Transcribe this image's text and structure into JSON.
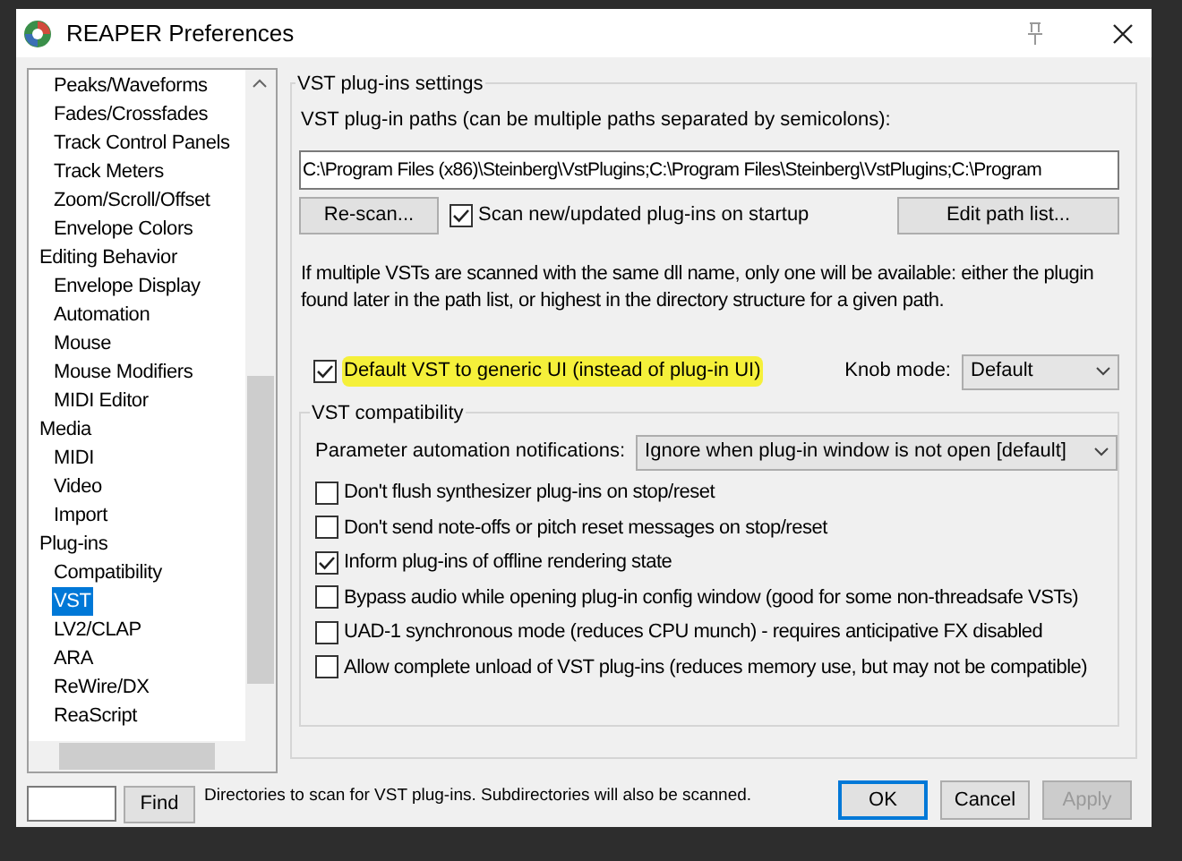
{
  "window": {
    "title": "REAPER Preferences"
  },
  "tree": {
    "items": [
      {
        "children": [
          {
            "label": "Peaks/Waveforms",
            "selected": false
          },
          {
            "label": "Fades/Crossfades",
            "selected": false
          },
          {
            "label": "Track Control Panels",
            "selected": false
          },
          {
            "label": "Track Meters",
            "selected": false
          },
          {
            "label": "Zoom/Scroll/Offset",
            "selected": false
          },
          {
            "label": "Envelope Colors",
            "selected": false
          }
        ]
      },
      {
        "label": "Editing Behavior",
        "selected": false,
        "children": [
          {
            "label": "Envelope Display",
            "selected": false
          },
          {
            "label": "Automation",
            "selected": false
          },
          {
            "label": "Mouse",
            "selected": false
          },
          {
            "label": "Mouse Modifiers",
            "selected": false
          },
          {
            "label": "MIDI Editor",
            "selected": false
          }
        ]
      },
      {
        "label": "Media",
        "selected": false,
        "children": [
          {
            "label": "MIDI",
            "selected": false
          },
          {
            "label": "Video",
            "selected": false
          },
          {
            "label": "Import",
            "selected": false
          }
        ]
      },
      {
        "label": "Plug-ins",
        "selected": false,
        "children": [
          {
            "label": "Compatibility",
            "selected": false
          },
          {
            "label": "VST",
            "selected": true
          },
          {
            "label": "LV2/CLAP",
            "selected": false
          },
          {
            "label": "ARA",
            "selected": false
          },
          {
            "label": "ReWire/DX",
            "selected": false
          },
          {
            "label": "ReaScript",
            "selected": false
          }
        ]
      }
    ]
  },
  "settings": {
    "group_title": "VST plug-ins settings",
    "paths_label": "VST plug-in paths (can be multiple paths separated by semicolons):",
    "paths_value": "C:\\Program Files (x86)\\Steinberg\\VstPlugins;C:\\Program Files\\Steinberg\\VstPlugins;C:\\Program",
    "rescan_button": "Re-scan...",
    "scan_on_startup": {
      "label": "Scan new/updated plug-ins on startup",
      "checked": true
    },
    "edit_path_button": "Edit path list...",
    "info": "If multiple VSTs are scanned with the same dll name, only one will be available: either the plugin found later in the path list, or highest in the directory structure for a given path.",
    "default_generic_ui": {
      "label": "Default VST to generic UI (instead of plug-in UI)",
      "checked": true,
      "highlighted": true
    },
    "knob_mode_label": "Knob mode:",
    "knob_mode_value": "Default"
  },
  "compatibility": {
    "group_title": "VST compatibility",
    "param_label": "Parameter automation notifications:",
    "param_value": "Ignore when plug-in window is not open [default]",
    "options": [
      {
        "label": "Don't flush synthesizer plug-ins on stop/reset",
        "checked": false
      },
      {
        "label": "Don't send note-offs or pitch reset messages on stop/reset",
        "checked": false
      },
      {
        "label": "Inform plug-ins of offline rendering state",
        "checked": true
      },
      {
        "label": "Bypass audio while opening plug-in config window (good for some non-threadsafe VSTs)",
        "checked": false
      },
      {
        "label": "UAD-1 synchronous mode (reduces CPU munch) - requires anticipative FX disabled",
        "checked": false
      },
      {
        "label": "Allow complete unload of VST plug-ins (reduces memory use, but may not be compatible)",
        "checked": false
      }
    ]
  },
  "footer": {
    "find_button": "Find",
    "hint": "Directories to scan for VST plug-ins. Subdirectories will also be scanned.",
    "buttons": [
      {
        "label": "OK",
        "kind": "default",
        "disabled": false
      },
      {
        "label": "Cancel",
        "kind": "normal",
        "disabled": false
      },
      {
        "label": "Apply",
        "kind": "normal",
        "disabled": true
      }
    ]
  }
}
